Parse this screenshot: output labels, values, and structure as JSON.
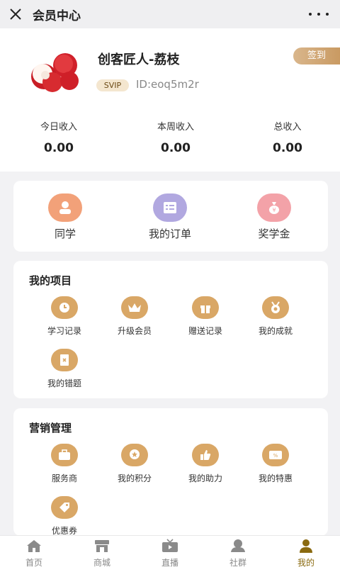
{
  "header": {
    "title": "会员中心"
  },
  "profile": {
    "name": "创客匠人-荔枝",
    "badge": "SVIP",
    "id": "ID:eoq5m2r",
    "checkin_label": "签到",
    "stats": [
      {
        "label": "今日收入",
        "value": "0.00"
      },
      {
        "label": "本周收入",
        "value": "0.00"
      },
      {
        "label": "总收入",
        "value": "0.00"
      }
    ]
  },
  "quick_links": [
    {
      "label": "同学",
      "icon": "person-icon",
      "color": "#f2a179"
    },
    {
      "label": "我的订单",
      "icon": "order-icon",
      "color": "#b1a8e0"
    },
    {
      "label": "奖学金",
      "icon": "money-bag-icon",
      "color": "#f3a2a8"
    }
  ],
  "projects": {
    "title": "我的项目",
    "items": [
      {
        "label": "学习记录",
        "icon": "clock-icon"
      },
      {
        "label": "升级会员",
        "icon": "crown-icon"
      },
      {
        "label": "赠送记录",
        "icon": "gift-icon"
      },
      {
        "label": "我的成就",
        "icon": "medal-icon"
      },
      {
        "label": "我的错题",
        "icon": "notebook-icon"
      }
    ]
  },
  "marketing": {
    "title": "营销管理",
    "items": [
      {
        "label": "服务商",
        "icon": "briefcase-icon"
      },
      {
        "label": "我的积分",
        "icon": "points-icon"
      },
      {
        "label": "我的助力",
        "icon": "thumbs-up-icon"
      },
      {
        "label": "我的特惠",
        "icon": "discount-icon"
      },
      {
        "label": "优惠券",
        "icon": "coupon-icon"
      }
    ]
  },
  "tabbar": {
    "items": [
      {
        "label": "首页",
        "icon": "home-icon"
      },
      {
        "label": "商城",
        "icon": "shop-icon"
      },
      {
        "label": "直播",
        "icon": "tv-icon"
      },
      {
        "label": "社群",
        "icon": "community-icon"
      },
      {
        "label": "我的",
        "icon": "profile-icon"
      }
    ],
    "active": "我的",
    "accent": "#8a6a10"
  },
  "colors": {
    "gold": "#d9a766",
    "page_bg": "#f2f2f4"
  }
}
